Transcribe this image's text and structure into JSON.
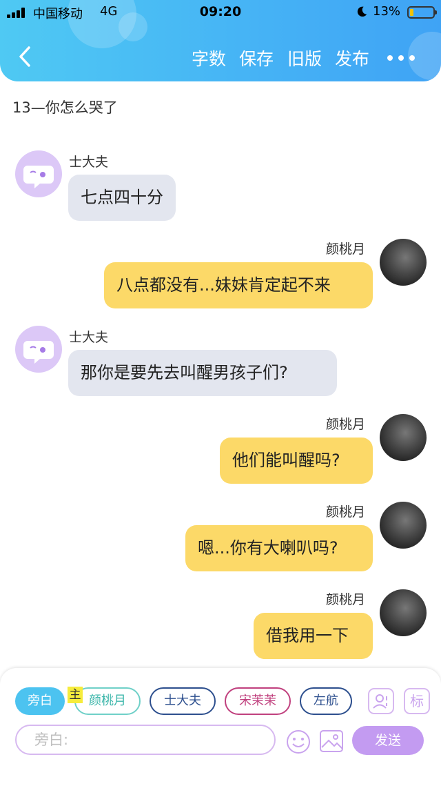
{
  "status_bar": {
    "carrier": "中国移动",
    "network": "4G",
    "time": "09:20",
    "battery": "13%"
  },
  "header": {
    "buttons": [
      "字数",
      "保存",
      "旧版",
      "发布"
    ],
    "back_icon": "chevron-left-icon",
    "more_icon": "more-icon"
  },
  "chapter_title": "13—你怎么哭了",
  "messages": [
    {
      "side": "left",
      "name": "士大夫",
      "text": "七点四十分"
    },
    {
      "side": "right",
      "name": "颜桃月",
      "text": "八点都没有...妹妹肯定起不来"
    },
    {
      "side": "left",
      "name": "士大夫",
      "text": "那你是要先去叫醒男孩子们?"
    },
    {
      "side": "right",
      "name": "颜桃月",
      "text": "他们能叫醒吗?"
    },
    {
      "side": "right",
      "name": "颜桃月",
      "text": "嗯...你有大喇叭吗?"
    },
    {
      "side": "right",
      "name": "颜桃月",
      "text": "借我用一下"
    }
  ],
  "composer": {
    "roles": [
      "旁白",
      "颜桃月",
      "士大夫",
      "宋茉茉",
      "左航"
    ],
    "main_marker": "主",
    "mark_button": "标",
    "placeholder": "旁白:",
    "send_label": "发送"
  },
  "colors": {
    "header": "#46b4f5",
    "left_bubble": "#e3e6ef",
    "right_bubble": "#fcd968",
    "accent_purple": "#c39bf1",
    "chip_active": "#4cc3f0"
  }
}
